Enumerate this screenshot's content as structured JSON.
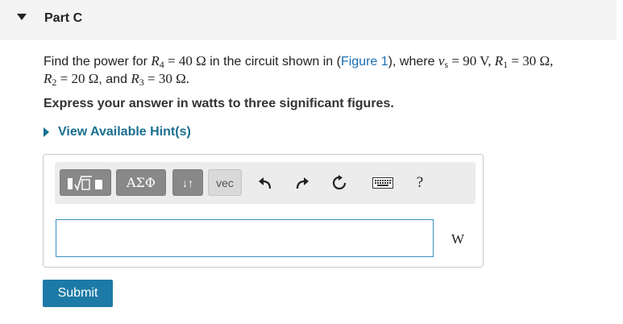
{
  "part": {
    "title": "Part C"
  },
  "problem": {
    "t1": "Find the power for ",
    "r4_var": "R",
    "r4_sub": "4",
    "r4_val": " = 40 Ω",
    "t2": " in the circuit shown in (",
    "figure_link": "Figure 1",
    "t3": "), where ",
    "vs_var": "v",
    "vs_sub": "s",
    "vs_val": " = 90 V, ",
    "r1_var": "R",
    "r1_sub": "1",
    "r1_val": " = 30 Ω,",
    "r2_var": "R",
    "r2_sub": "2",
    "r2_val": " = 20 Ω",
    "t4": ", and ",
    "r3_var": "R",
    "r3_sub": "3",
    "r3_val": " = 30 Ω."
  },
  "instruction": "Express your answer in watts to three significant figures.",
  "hint": {
    "label": "View Available Hint(s)"
  },
  "toolbar": {
    "templates_icon": "templates-icon",
    "greek_label": "ΑΣΦ",
    "arrows_label": "↓↑",
    "vec_label": "vec",
    "undo_icon": "undo-icon",
    "redo_icon": "redo-icon",
    "reset_icon": "reset-icon",
    "keyboard_icon": "keyboard-icon",
    "help_label": "?"
  },
  "answer": {
    "value": "",
    "placeholder": "",
    "unit": "W"
  },
  "submit": {
    "label": "Submit"
  },
  "colors": {
    "link": "#1a6fb5",
    "hint": "#1a6f8f",
    "submit": "#1d7aa6",
    "input_border": "#3a8fc2"
  }
}
